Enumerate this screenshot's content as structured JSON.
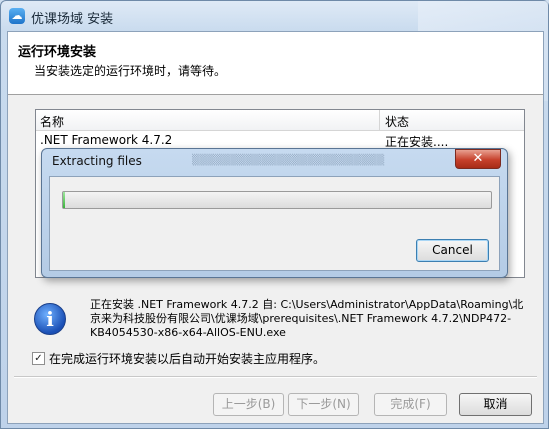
{
  "window": {
    "title": "优课场域 安装"
  },
  "header": {
    "title": "运行环境安装",
    "subtitle": "当安装选定的运行环境时，请等待。"
  },
  "list": {
    "columns": [
      "名称",
      "状态"
    ],
    "rows": [
      {
        "name": ".NET Framework 4.7.2",
        "status": "正在安装...."
      }
    ]
  },
  "info": {
    "icon": "info-icon",
    "text": "正在安装 .NET Framework 4.7.2 自: C:\\Users\\Administrator\\AppData\\Roaming\\北京来为科技股份有限公司\\优课场域\\prerequisites\\.NET Framework 4.7.2\\NDP472-KB4054530-x86-x64-AllOS-ENU.exe"
  },
  "auto_start": {
    "checked": true,
    "label": "在完成运行环境安装以后自动开始安装主应用程序。"
  },
  "buttons": {
    "back": "上一步(B)",
    "next": "下一步(N)",
    "finish": "完成(F)",
    "cancel": "取消"
  },
  "dialog": {
    "title": "Extracting files",
    "close_label": "✕",
    "progress": 0.005,
    "cancel_label": "Cancel"
  },
  "colors": {
    "progress": "#3cb43c",
    "close": "#c6402b",
    "accent": "#3c7fb1"
  }
}
